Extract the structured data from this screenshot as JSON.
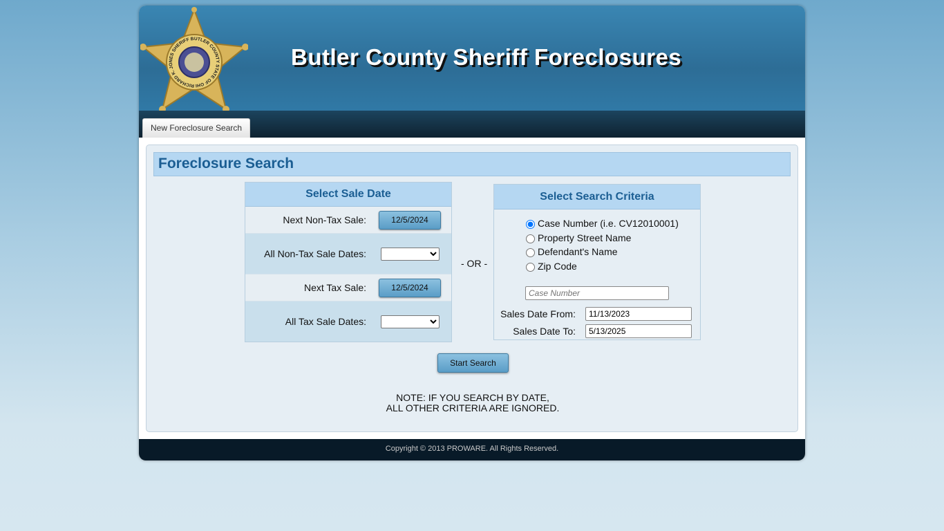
{
  "header": {
    "title": "Butler County Sheriff Foreclosures",
    "badge_text": "RICHARD K. JONES SHERIFF BUTLER COUNTY STATE OF OHIO"
  },
  "nav": {
    "tab": "New Foreclosure Search"
  },
  "main": {
    "title": "Foreclosure Search",
    "sale_date": {
      "heading": "Select Sale Date",
      "next_non_tax_label": "Next Non-Tax Sale:",
      "next_non_tax_value": "12/5/2024",
      "all_non_tax_label": "All Non-Tax Sale Dates:",
      "next_tax_label": "Next Tax Sale:",
      "next_tax_value": "12/5/2024",
      "all_tax_label": "All Tax Sale Dates:"
    },
    "or_label": "- OR -",
    "criteria": {
      "heading": "Select Search Criteria",
      "options": [
        "Case Number (i.e. CV12010001)",
        "Property Street Name",
        "Defendant's Name",
        "Zip Code"
      ],
      "selected": 0,
      "input_placeholder": "Case Number",
      "from_label": "Sales Date From:",
      "from_value": "11/13/2023",
      "to_label": "Sales Date To:",
      "to_value": "5/13/2025"
    },
    "start_button": "Start Search",
    "note_line1": "NOTE: IF YOU SEARCH BY DATE,",
    "note_line2": "ALL OTHER CRITERIA ARE IGNORED."
  },
  "footer": {
    "copyright": "Copyright © 2013 PROWARE. All Rights Reserved."
  }
}
